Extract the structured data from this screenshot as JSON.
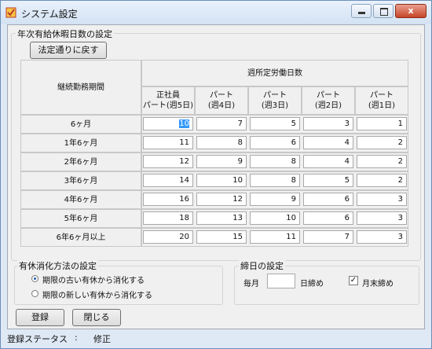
{
  "window": {
    "title": "システム設定",
    "close_glyph": "x"
  },
  "annual_leave": {
    "group_title": "年次有給休暇日数の設定",
    "reset_button": "法定通りに戻す",
    "row_header": "継続勤務期間",
    "weekly_header": "週所定労働日数",
    "columns": [
      "正社員\nパート(週5日)",
      "パート\n(週4日)",
      "パート\n(週3日)",
      "パート\n(週2日)",
      "パート\n(週1日)"
    ],
    "rows": [
      {
        "label": "6ヶ月",
        "values": [
          "10",
          "7",
          "5",
          "3",
          "1"
        ]
      },
      {
        "label": "1年6ヶ月",
        "values": [
          "11",
          "8",
          "6",
          "4",
          "2"
        ]
      },
      {
        "label": "2年6ヶ月",
        "values": [
          "12",
          "9",
          "8",
          "4",
          "2"
        ]
      },
      {
        "label": "3年6ヶ月",
        "values": [
          "14",
          "10",
          "8",
          "5",
          "2"
        ]
      },
      {
        "label": "4年6ヶ月",
        "values": [
          "16",
          "12",
          "9",
          "6",
          "3"
        ]
      },
      {
        "label": "5年6ヶ月",
        "values": [
          "18",
          "13",
          "10",
          "6",
          "3"
        ]
      },
      {
        "label": "6年6ヶ月以上",
        "values": [
          "20",
          "15",
          "11",
          "7",
          "3"
        ]
      }
    ]
  },
  "consumption": {
    "group_title": "有休消化方法の設定",
    "option_old": "期限の古い有休から消化する",
    "option_new": "期限の新しい有休から消化する",
    "selected": "old"
  },
  "closing": {
    "group_title": "締日の設定",
    "prefix": "毎月",
    "day_value": "",
    "suffix": "日締め",
    "month_end_label": "月末締め",
    "month_end_checked": true,
    "check_glyph": "✓"
  },
  "buttons": {
    "register": "登録",
    "close": "閉じる"
  },
  "status": {
    "label": "登録ステータス",
    "separator": ":",
    "value": "修正"
  }
}
